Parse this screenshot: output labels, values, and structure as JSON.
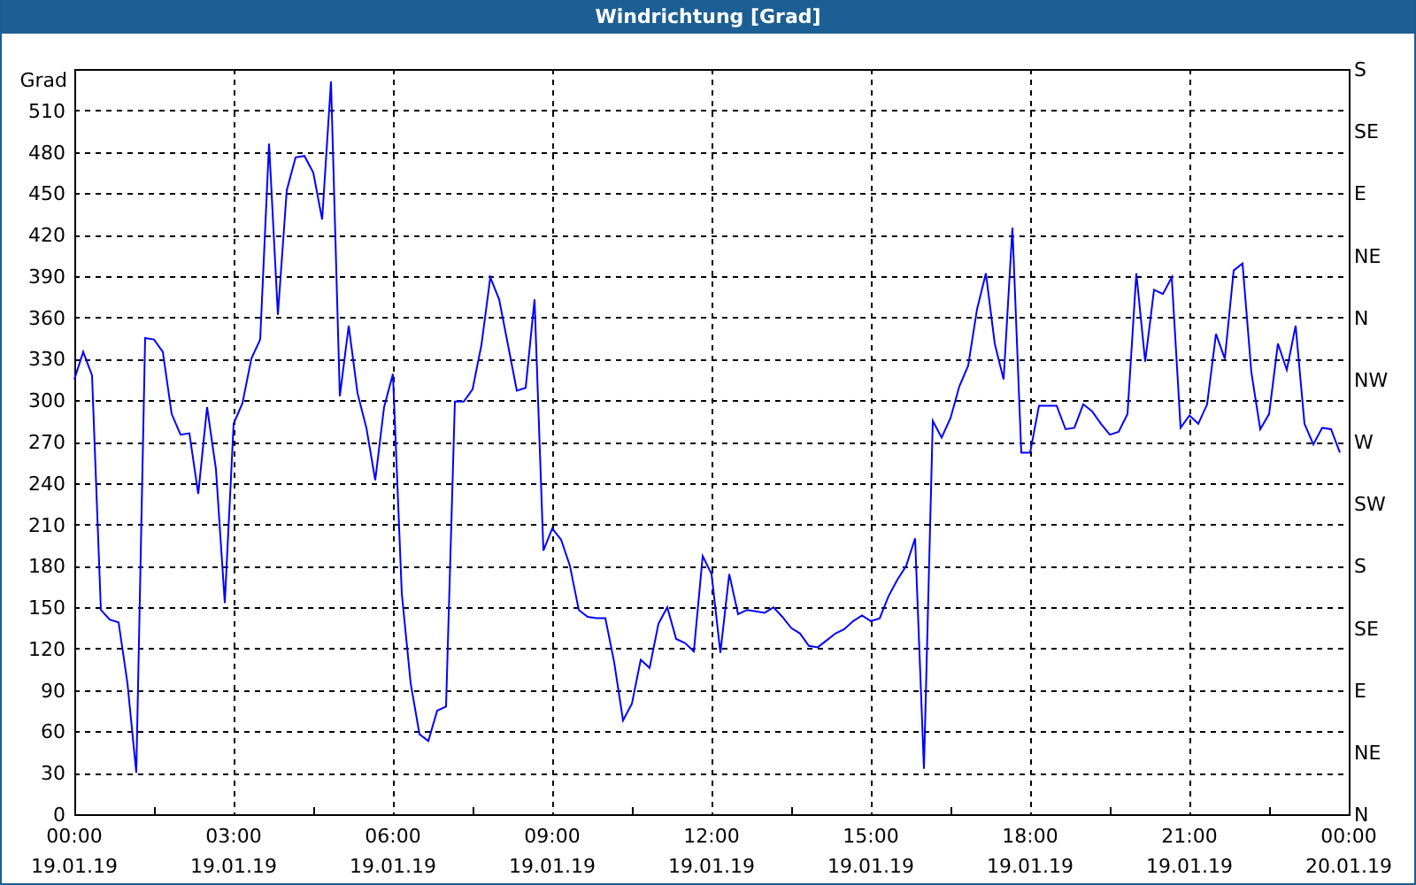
{
  "window": {
    "title": "Windrichtung [Grad]"
  },
  "chart": {
    "chart_data": {
      "type": "line",
      "grid": true,
      "ylabel": "Grad",
      "ylim": [
        0,
        540
      ],
      "yticks": [
        0,
        30,
        60,
        90,
        120,
        150,
        180,
        210,
        240,
        270,
        300,
        330,
        360,
        390,
        420,
        450,
        480,
        510
      ],
      "categories": [
        "00:00\n19.01.19",
        null,
        null,
        null,
        null,
        null,
        null,
        null,
        null,
        null,
        null,
        null,
        null,
        null,
        null,
        null,
        null,
        null,
        "03:00\n19.01.19",
        null,
        null,
        null,
        null,
        null,
        null,
        null,
        null,
        null,
        null,
        null,
        null,
        null,
        null,
        null,
        null,
        null,
        "06:00\n19.01.19",
        null,
        null,
        null,
        null,
        null,
        null,
        null,
        null,
        null,
        null,
        null,
        null,
        null,
        null,
        null,
        null,
        null,
        "09:00\n19.01.19",
        null,
        null,
        null,
        null,
        null,
        null,
        null,
        null,
        null,
        null,
        null,
        null,
        null,
        null,
        null,
        null,
        null,
        "12:00\n19.01.19",
        null,
        null,
        null,
        null,
        null,
        null,
        null,
        null,
        null,
        null,
        null,
        null,
        null,
        null,
        null,
        null,
        null,
        "15:00\n19.01.19",
        null,
        null,
        null,
        null,
        null,
        null,
        null,
        null,
        null,
        null,
        null,
        null,
        null,
        null,
        null,
        null,
        null,
        "18:00\n19.01.19",
        null,
        null,
        null,
        null,
        null,
        null,
        null,
        null,
        null,
        null,
        null,
        null,
        null,
        null,
        null,
        null,
        null,
        "21:00\n19.01.19",
        null,
        null,
        null,
        null,
        null,
        null,
        null,
        null,
        null,
        null,
        null,
        null,
        null,
        null,
        null,
        null,
        null,
        "00:00\n20.01.19"
      ],
      "series": [
        {
          "color": "#0000ff",
          "values": [
            315,
            335,
            318,
            148,
            141,
            139,
            95,
            30,
            345,
            344,
            335,
            290,
            275,
            276,
            232,
            295,
            250,
            153,
            283,
            298,
            330,
            344,
            486,
            362,
            452,
            476,
            477,
            465,
            431,
            531,
            303,
            354,
            305,
            280,
            242,
            295,
            319,
            160,
            95,
            58,
            53,
            75,
            78,
            299,
            299,
            308,
            340,
            389,
            373,
            340,
            307,
            309,
            373,
            191,
            207,
            199,
            180,
            148,
            143,
            142,
            142,
            110,
            68,
            80,
            112,
            106,
            138,
            150,
            127,
            124,
            118,
            187,
            174,
            117,
            174,
            145,
            148,
            147,
            146,
            150,
            143,
            135,
            131,
            122,
            121,
            126,
            131,
            134,
            140,
            144,
            140,
            142,
            158,
            170,
            180,
            200,
            33,
            285,
            273,
            287,
            310,
            325,
            366,
            392,
            341,
            315,
            425,
            262,
            262,
            296,
            296,
            296,
            279,
            280,
            297,
            292,
            283,
            275,
            277,
            290,
            392,
            328,
            380,
            377,
            389,
            280,
            289,
            283,
            297,
            348,
            330,
            394,
            399,
            320,
            279,
            290,
            341,
            322,
            354,
            283,
            268,
            280,
            279,
            262,
            null
          ]
        }
      ]
    },
    "right_axis": {
      "labels": [
        "S",
        "SE",
        "E",
        "NE",
        "N",
        "NW",
        "W",
        "SW",
        "S",
        "SE",
        "E",
        "NE",
        "N"
      ]
    }
  }
}
